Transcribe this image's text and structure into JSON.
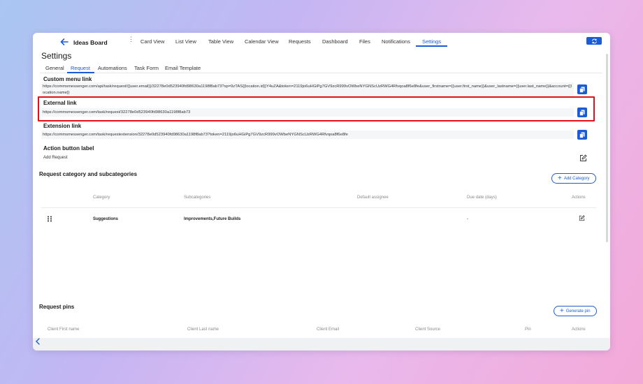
{
  "board": {
    "title": "Ideas Board"
  },
  "nav": {
    "items": [
      {
        "label": "Card View"
      },
      {
        "label": "List View"
      },
      {
        "label": "Table View"
      },
      {
        "label": "Calendar View"
      },
      {
        "label": "Requests"
      },
      {
        "label": "Dashboard"
      },
      {
        "label": "Files"
      },
      {
        "label": "Notifications"
      },
      {
        "label": "Settings",
        "active": true
      }
    ]
  },
  "page": {
    "title": "Settings"
  },
  "tabs": [
    {
      "label": "General"
    },
    {
      "label": "Request",
      "active": true
    },
    {
      "label": "Automations"
    },
    {
      "label": "Task Form"
    },
    {
      "label": "Email Template"
    }
  ],
  "links": {
    "custom_menu": {
      "label": "Custom menu link",
      "value": "https://commsmessenger.com/api/task/request/{{user.email}}/32278e0d523940fd98630a1198f8ab73?sp=9zTAS{{location.id}}Y4uZA&token=2119jo6uHGiPg7GV9zcR999vOWbeNYGNScUzRWG4Rfvqoa8f6e8fe&user_firstname={{user.first_name}}&user_lastname={{user.last_name}}&account={{location.name}}"
    },
    "external": {
      "label": "External link",
      "value": "https://commsmessenger.com/task/request/32278e0d523940fd98630a1198f8ab73"
    },
    "extension": {
      "label": "Extension link",
      "value": "https://commsmessenger.com/task/requestextension/32278e0d523940fd98630a1198f8ab73?token=2119jo6uHGiPg7GV9zcR999vOWbeNYGNScUzRWG4Rfvqoa8f6e8fe"
    }
  },
  "action_button": {
    "label": "Action button label",
    "value": "Add Request"
  },
  "categories": {
    "title": "Request category and subcategories",
    "add_label": "Add Category",
    "columns": [
      "Category",
      "Subcategories",
      "Default assignee",
      "Due date (days)",
      "Actions"
    ],
    "rows": [
      {
        "category": "Suggestions",
        "subcategories": "Improvements,Future Builds",
        "assignee": "",
        "due": "-"
      }
    ]
  },
  "pins": {
    "title": "Request pins",
    "generate_label": "Generate pin",
    "columns": [
      "Client First name",
      "Client Last name",
      "Client Email",
      "Client Source",
      "Pin",
      "Actions"
    ]
  },
  "colors": {
    "accent": "#1a5cd8",
    "highlight": "#e3101a"
  },
  "icons": {
    "back": "arrow-left-icon",
    "refresh": "refresh-icon",
    "copy": "copy-icon",
    "edit": "edit-icon",
    "drag": "drag-handle-icon",
    "collapse": "chevron-left-icon"
  }
}
